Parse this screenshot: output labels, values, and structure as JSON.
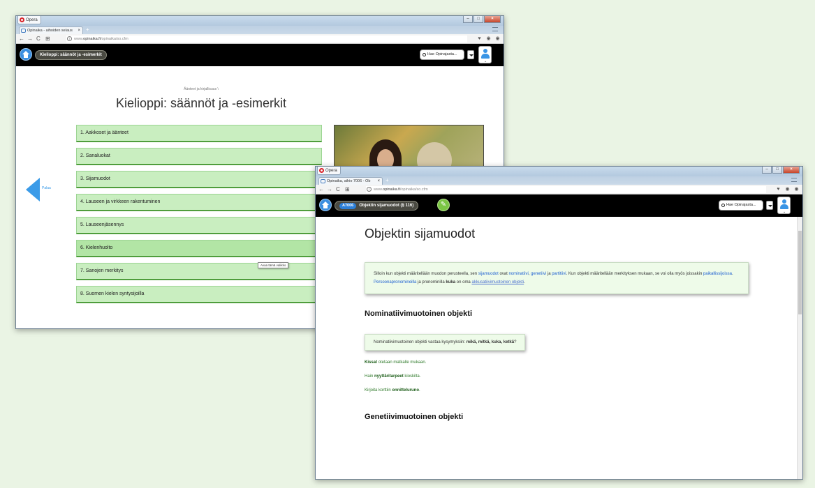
{
  "window1": {
    "opera_label": "Opera",
    "tab_title": "Opinaika - aihoiden selaus",
    "url_prefix": "www.",
    "url_domain": "opinaika.fi",
    "url_path": "/opinaika/so.cfm",
    "breadcrumb_pill": "Kielioppi: säännöt ja -esimerkit",
    "search_placeholder": "Hae Opinajasta...",
    "small_crumb": "Äänteet ja kirjallisuus \\",
    "page_title": "Kielioppi: säännöt ja -esimerkit",
    "back_label": "Palaa",
    "menu_items": [
      "1. Aakkoset ja äänteet",
      "2. Sanaluokat",
      "3. Sijamuodot",
      "4. Lauseen ja virkkeen rakentuminen",
      "5. Lauseenjäsennys",
      "6. Kielenhuolto",
      "7. Sanojen merkitys",
      "8. Suomen kielen syntysijoilla"
    ],
    "tooltip": "Avaa tämä valikko"
  },
  "window2": {
    "opera_label": "Opera",
    "tab_title": "Opinaika, aihio 7006 - Ob",
    "url_prefix": "www.",
    "url_domain": "opinaika.fi",
    "url_path": "/opinaika/so.cfm",
    "code_badge": "A7006",
    "breadcrumb_pill": "Objektin sijamuodot (§ 116)",
    "search_placeholder": "Hae Opinajasta...",
    "page_title": "Objektin sijamuodot",
    "intro": {
      "t1": "Silloin kun objekti määritellään muodon perusteella, sen ",
      "l1": "sijamuodot",
      "t2": " ovat ",
      "l2": "nominatiivi",
      "t3": ", ",
      "l3": "genetiivi",
      "t4": " ja ",
      "l4": "partitiivi",
      "t5": ". Kun objekti määritellään merkityksen mukaan, se voi olla myös joissakin ",
      "l5": "paikallissijoissa",
      "t6": ". ",
      "l6": "Persoonapronomineilla",
      "t7": " ja pronominilla ",
      "b1": "kuka",
      "t8": " on oma ",
      "l7": "akkusatiivimuotoinen objekti",
      "t9": "."
    },
    "section1_title": "Nominatiivimuotoinen objekti",
    "question": {
      "text": "Nominatiivimuotoinen objekti vastaa kysymyksiin: ",
      "words": "mikä, mitkä, kuka, ketkä",
      "end": "?"
    },
    "examples": [
      {
        "bold": "Kissat",
        "rest": " otetaan matkalle mukaan."
      },
      {
        "pre": "Hain ",
        "bold": "nyyttäritarpeet",
        "rest": " kioskilta."
      },
      {
        "pre": "Kirjoita korttiin ",
        "bold": "onnitteluruno",
        "rest": "."
      }
    ],
    "section2_title": "Genetiivimuotoinen objekti"
  },
  "icons": {
    "home": "home-icon",
    "wrench": "wrench-icon",
    "search": "search-icon",
    "user": "user-icon",
    "back": "back-arrow-icon"
  },
  "colors": {
    "accent_blue": "#3b8fe0",
    "menu_green": "#c9eec0",
    "wrench_green": "#7bc544",
    "page_bg": "#eaf4e4"
  }
}
